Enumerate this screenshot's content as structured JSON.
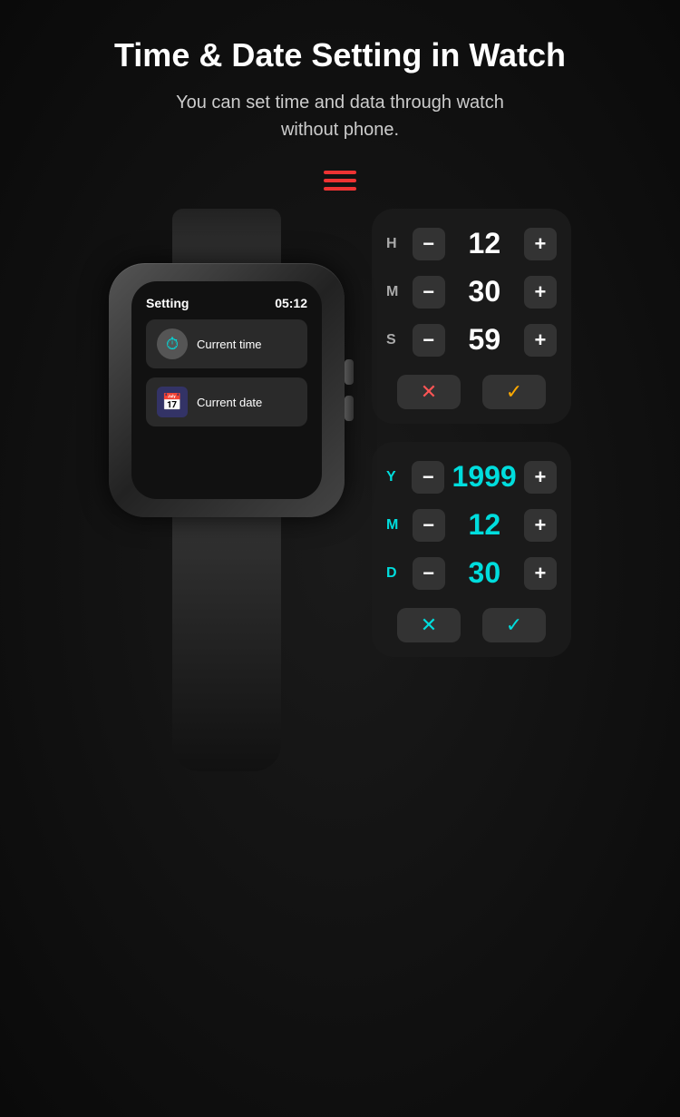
{
  "header": {
    "title": "Time & Date Setting in Watch",
    "subtitle": "You can set time and data through watch\nwithout phone."
  },
  "watch": {
    "status": {
      "label": "Setting",
      "time": "05:12"
    },
    "menu": [
      {
        "id": "current-time",
        "icon": "⏱",
        "label": "Current time",
        "iconType": "cyan"
      },
      {
        "id": "current-date",
        "icon": "📅",
        "label": "Current date",
        "iconType": "blue"
      }
    ]
  },
  "time_panel": {
    "rows": [
      {
        "label": "H",
        "value": "12"
      },
      {
        "label": "M",
        "value": "30"
      },
      {
        "label": "S",
        "value": "59"
      }
    ],
    "cancel_label": "✕",
    "confirm_label": "✓"
  },
  "date_panel": {
    "rows": [
      {
        "label": "Y",
        "value": "1999"
      },
      {
        "label": "M",
        "value": "12"
      },
      {
        "label": "D",
        "value": "30"
      }
    ],
    "cancel_label": "✕",
    "confirm_label": "✓"
  }
}
